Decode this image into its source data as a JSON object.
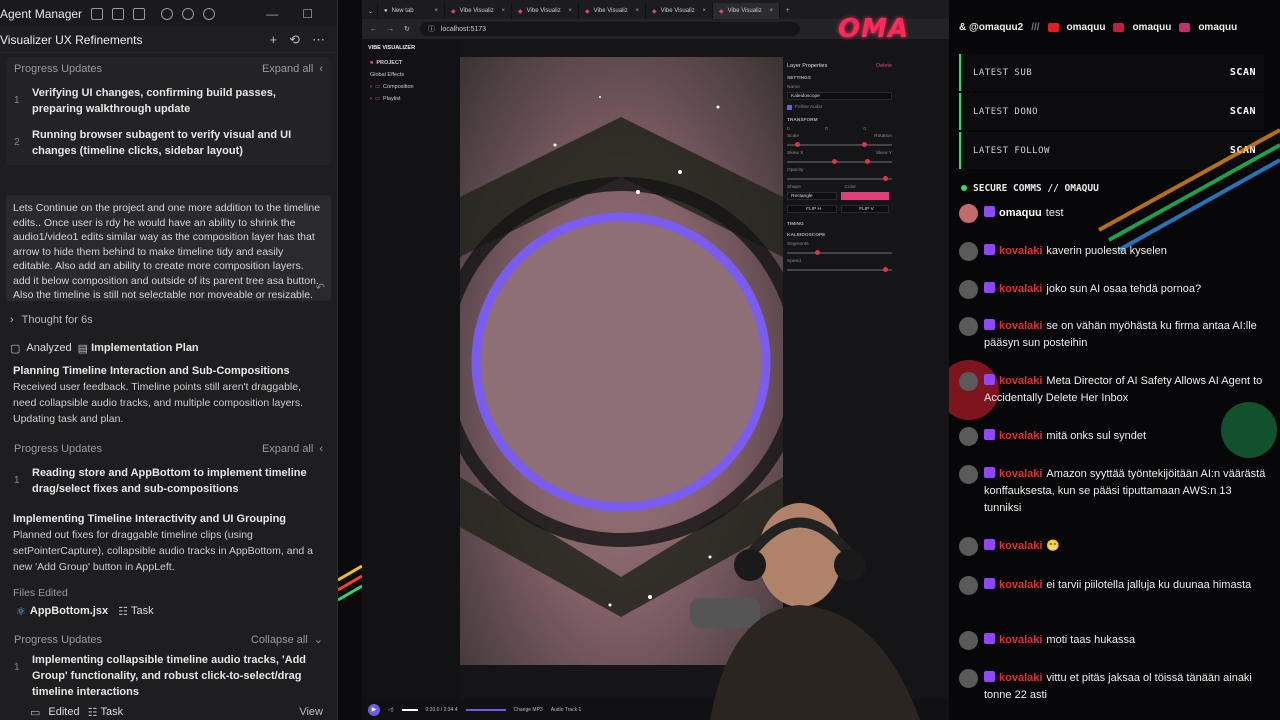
{
  "agent": {
    "window_title": "Agent Manager",
    "conversation_title": "Visualizer UX Refinements",
    "progress1": {
      "header": "Progress Updates",
      "expand": "Expand all",
      "steps": [
        {
          "num": "1",
          "text": "Verifying UI changes, confirming build passes, preparing walkthrough update"
        },
        {
          "num": "2",
          "text": "Running browser subagent to verify visual and UI changes (timeline clicks, sidebar layout)"
        }
      ]
    },
    "user_message": "Lets Continue on the project and one more addition to the timeline edits.. Once user is rdy he would have an ability to shrink the audio1/video1 edits similar way as the composition layer has that arrow to hide them behind to make timeline tidy and easily editable. Also add an ability to create more composition layers. add it below composition and outside of its parent tree asa button. Also the timeline is still not selectable nor moveable or resizable.",
    "thought": "Thought for 6s",
    "analyzed_label": "Analyzed",
    "analyzed_file": "Implementation Plan",
    "block1": {
      "title": "Planning Timeline Interaction and Sub-Compositions",
      "body": "Received user feedback. Timeline points still aren't draggable, need collapsible audio tracks, and multiple composition layers. Updating task and plan."
    },
    "progress2": {
      "header": "Progress Updates",
      "expand": "Expand all",
      "steps": [
        {
          "num": "1",
          "text": "Reading store and AppBottom to implement timeline drag/select fixes and sub-compositions"
        }
      ]
    },
    "block2": {
      "title": "Implementing Timeline Interactivity and UI Grouping",
      "body": "Planned out fixes for draggable timeline clips (using setPointerCapture), collapsible audio tracks in AppBottom, and a new 'Add Group' button in AppLeft."
    },
    "files_edited_label": "Files Edited",
    "files": [
      "AppBottom.jsx",
      "Task"
    ],
    "progress3": {
      "header": "Progress Updates",
      "collapse": "Collapse all",
      "steps": [
        {
          "num": "1",
          "text": "Implementing collapsible timeline audio tracks, 'Add Group' functionality, and robust click-to-select/drag timeline interactions"
        }
      ]
    },
    "footer": {
      "edited": "Edited",
      "task": "Task",
      "view": "View"
    }
  },
  "browser": {
    "tabs": [
      "New tab",
      "Vibe Visualiz",
      "Vibe Visualiz",
      "Vibe Visualiz",
      "Vibe Visualiz",
      "Vibe Visualiz"
    ],
    "url": "localhost:5173",
    "app": {
      "brand": "VIBE VISUALIZER",
      "project_label": "PROJECT",
      "tree": [
        "Global Effects",
        "Composition",
        "Playlist"
      ],
      "props": {
        "title": "Layer Properties",
        "delete": "Delete",
        "settings": "SETTINGS",
        "name_label": "Name",
        "name_value": "Kaleidoscope",
        "follow_audio": "Follow Audio",
        "transform": "TRANSFORM",
        "xyz": [
          "0",
          "0",
          "0"
        ],
        "scale": "Scale",
        "rotation": "Rotation",
        "skew_x": "Skew X",
        "skew_y": "Skew Y",
        "opacity": "Opacity",
        "shape_label": "Shape",
        "shape_value": "Rectangle",
        "color_label": "Color",
        "flip_h": "FLIP H",
        "flip_v": "FLIP V",
        "timing": "TIMING",
        "kaleidoscope": "KALEIDOSCOPE",
        "segments": "Segments",
        "speed": "Speed"
      },
      "playbar": {
        "time": "0:20.0 / 2:34.4",
        "change": "Change MP3",
        "track": "Audio Track 1"
      }
    }
  },
  "overlay": {
    "logo": "OMA",
    "ticker": [
      "& @omaquu2",
      "omaquu",
      "omaquu",
      "omaquu"
    ],
    "stats": [
      {
        "label": "LATEST SUB",
        "value": "SCAN"
      },
      {
        "label": "LATEST DONO",
        "value": "SCAN"
      },
      {
        "label": "LATEST FOLLOW",
        "value": "SCAN"
      }
    ],
    "chat_title": "SECURE COMMS // OMAQUU",
    "messages": [
      {
        "name": "omaquu",
        "text": "test",
        "self": true
      },
      {
        "name": "kovalaki",
        "text": "kaverin puolesta kyselen"
      },
      {
        "name": "kovalaki",
        "text": "joko sun AI osaa tehdä pornoa?"
      },
      {
        "name": "kovalaki",
        "text": "se on vähän myöhästä ku firma antaa AI:lle pääsyn sun posteihin"
      },
      {
        "name": "kovalaki",
        "text": "Meta Director of AI Safety Allows AI Agent to Accidentally Delete Her Inbox"
      },
      {
        "name": "kovalaki",
        "text": "mitä onks sul syndet"
      },
      {
        "name": "kovalaki",
        "text": "Amazon syyttää työntekijöitään AI:n väärästä konffauksesta, kun se pääsi tiputtamaan AWS:n 13 tunniksi"
      },
      {
        "name": "kovalaki",
        "text": "😁"
      },
      {
        "name": "kovalaki",
        "text": "ei tarvii piilotella jalluja ku duunaa himasta"
      },
      {
        "name": "kovalaki",
        "text": "moti taas hukassa"
      },
      {
        "name": "kovalaki",
        "text": "vittu et pitäs jaksaa ol töissä tänään ainaki tonne 22 asti"
      }
    ]
  }
}
